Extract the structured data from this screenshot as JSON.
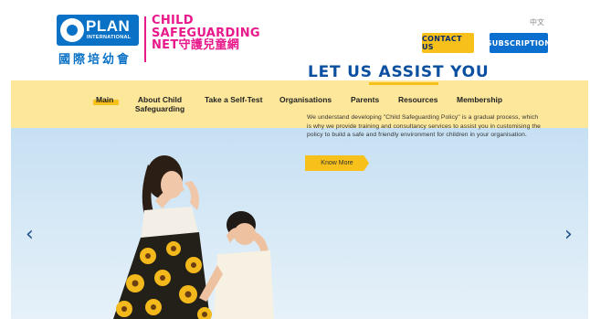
{
  "logo": {
    "plan_word": "PLAN",
    "plan_international": "INTERNATIONAL",
    "plan_cn": "國際培幼會",
    "csn_line1": "CHILD",
    "csn_line2": "SAFEGUARDING",
    "csn_line3_en": "NET",
    "csn_line3_cn": "守護兒童網"
  },
  "header": {
    "language": "中文",
    "contact_label": "CONTACT US",
    "subscription_label": "SUBSCRIPTION"
  },
  "nav": {
    "items": [
      {
        "label": "Main",
        "active": true
      },
      {
        "label": "About Child Safeguarding"
      },
      {
        "label": "Take a Self-Test"
      },
      {
        "label": "Organisations"
      },
      {
        "label": "Parents"
      },
      {
        "label": "Resources"
      },
      {
        "label": "Membership"
      }
    ]
  },
  "hero": {
    "prev_arrow": "‹",
    "next_arrow": "›",
    "title": "LET US ASSIST YOU",
    "text": "We understand developing \"Child Safeguarding Policy\" is a gradual process, which is why we provide training and consultancy services to assist you in customising the policy to build a safe and friendly environment for children in your organisation.",
    "cta_label": "Know More"
  },
  "colors": {
    "brand_blue": "#0a72c6",
    "brand_pink": "#e8198b",
    "accent_yellow": "#f8c01b",
    "nav_bg": "#fde79a"
  }
}
